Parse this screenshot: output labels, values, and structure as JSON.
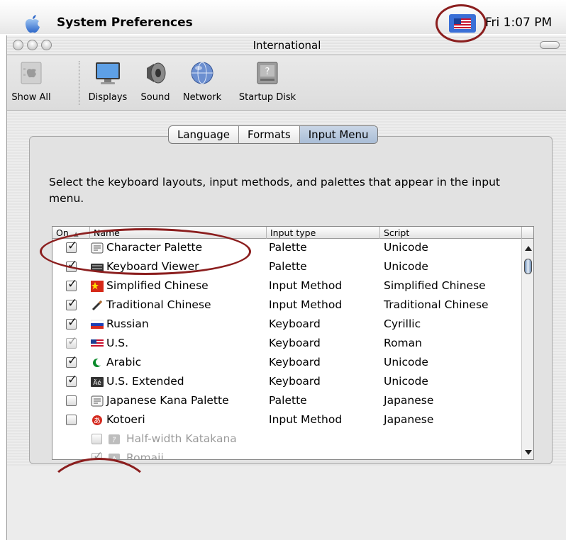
{
  "menubar": {
    "app_title": "System Preferences",
    "clock": "Fri 1:07 PM",
    "input_menu_icon": "us-flag-icon"
  },
  "window": {
    "title": "International"
  },
  "toolbar": {
    "items": [
      {
        "label": "Show All",
        "icon": "show-all-icon"
      },
      {
        "label": "Displays",
        "icon": "displays-icon"
      },
      {
        "label": "Sound",
        "icon": "sound-icon"
      },
      {
        "label": "Network",
        "icon": "network-icon"
      },
      {
        "label": "Startup Disk",
        "icon": "startup-disk-icon"
      }
    ]
  },
  "tabs": [
    {
      "label": "Language",
      "active": false
    },
    {
      "label": "Formats",
      "active": false
    },
    {
      "label": "Input Menu",
      "active": true
    }
  ],
  "description": "Select the keyboard layouts, input methods, and palettes that appear in the input menu.",
  "table": {
    "headers": {
      "on": "On",
      "name": "Name",
      "input_type": "Input type",
      "script": "Script"
    },
    "rows": [
      {
        "checked": true,
        "dimmed": false,
        "name": "Character Palette",
        "input_type": "Palette",
        "script": "Unicode",
        "icon": "palette-icon"
      },
      {
        "checked": true,
        "dimmed": false,
        "name": "Keyboard Viewer",
        "input_type": "Palette",
        "script": "Unicode",
        "icon": "keyboard-icon"
      },
      {
        "checked": true,
        "dimmed": false,
        "name": "Simplified Chinese",
        "input_type": "Input Method",
        "script": "Simplified Chinese",
        "icon": "simplified-chinese-icon"
      },
      {
        "checked": true,
        "dimmed": false,
        "name": "Traditional Chinese",
        "input_type": "Input Method",
        "script": "Traditional Chinese",
        "icon": "brush-icon"
      },
      {
        "checked": true,
        "dimmed": false,
        "name": "Russian",
        "input_type": "Keyboard",
        "script": "Cyrillic",
        "icon": "russian-flag-icon"
      },
      {
        "checked": true,
        "dimmed": true,
        "name": "U.S.",
        "input_type": "Keyboard",
        "script": "Roman",
        "icon": "us-flag-icon"
      },
      {
        "checked": true,
        "dimmed": false,
        "name": "Arabic",
        "input_type": "Keyboard",
        "script": "Unicode",
        "icon": "crescent-icon"
      },
      {
        "checked": true,
        "dimmed": false,
        "name": "U.S. Extended",
        "input_type": "Keyboard",
        "script": "Unicode",
        "icon": "extended-keyboard-icon"
      },
      {
        "checked": false,
        "dimmed": false,
        "name": "Japanese Kana Palette",
        "input_type": "Palette",
        "script": "Japanese",
        "icon": "palette-icon"
      },
      {
        "checked": false,
        "dimmed": false,
        "name": "Kotoeri",
        "input_type": "Input Method",
        "script": "Japanese",
        "icon": "kotoeri-icon"
      },
      {
        "checked": false,
        "dimmed": true,
        "name": "Half-width Katakana",
        "input_type": "",
        "script": "",
        "icon": "katakana-icon"
      },
      {
        "checked": true,
        "dimmed": true,
        "name": "Romaji",
        "input_type": "",
        "script": "",
        "icon": "romaji-icon"
      }
    ]
  },
  "colors": {
    "annotation_ring": "#8b1e1e",
    "selected_tab": "#b3c4da",
    "scroll_thumb": "#6a8cb5"
  }
}
